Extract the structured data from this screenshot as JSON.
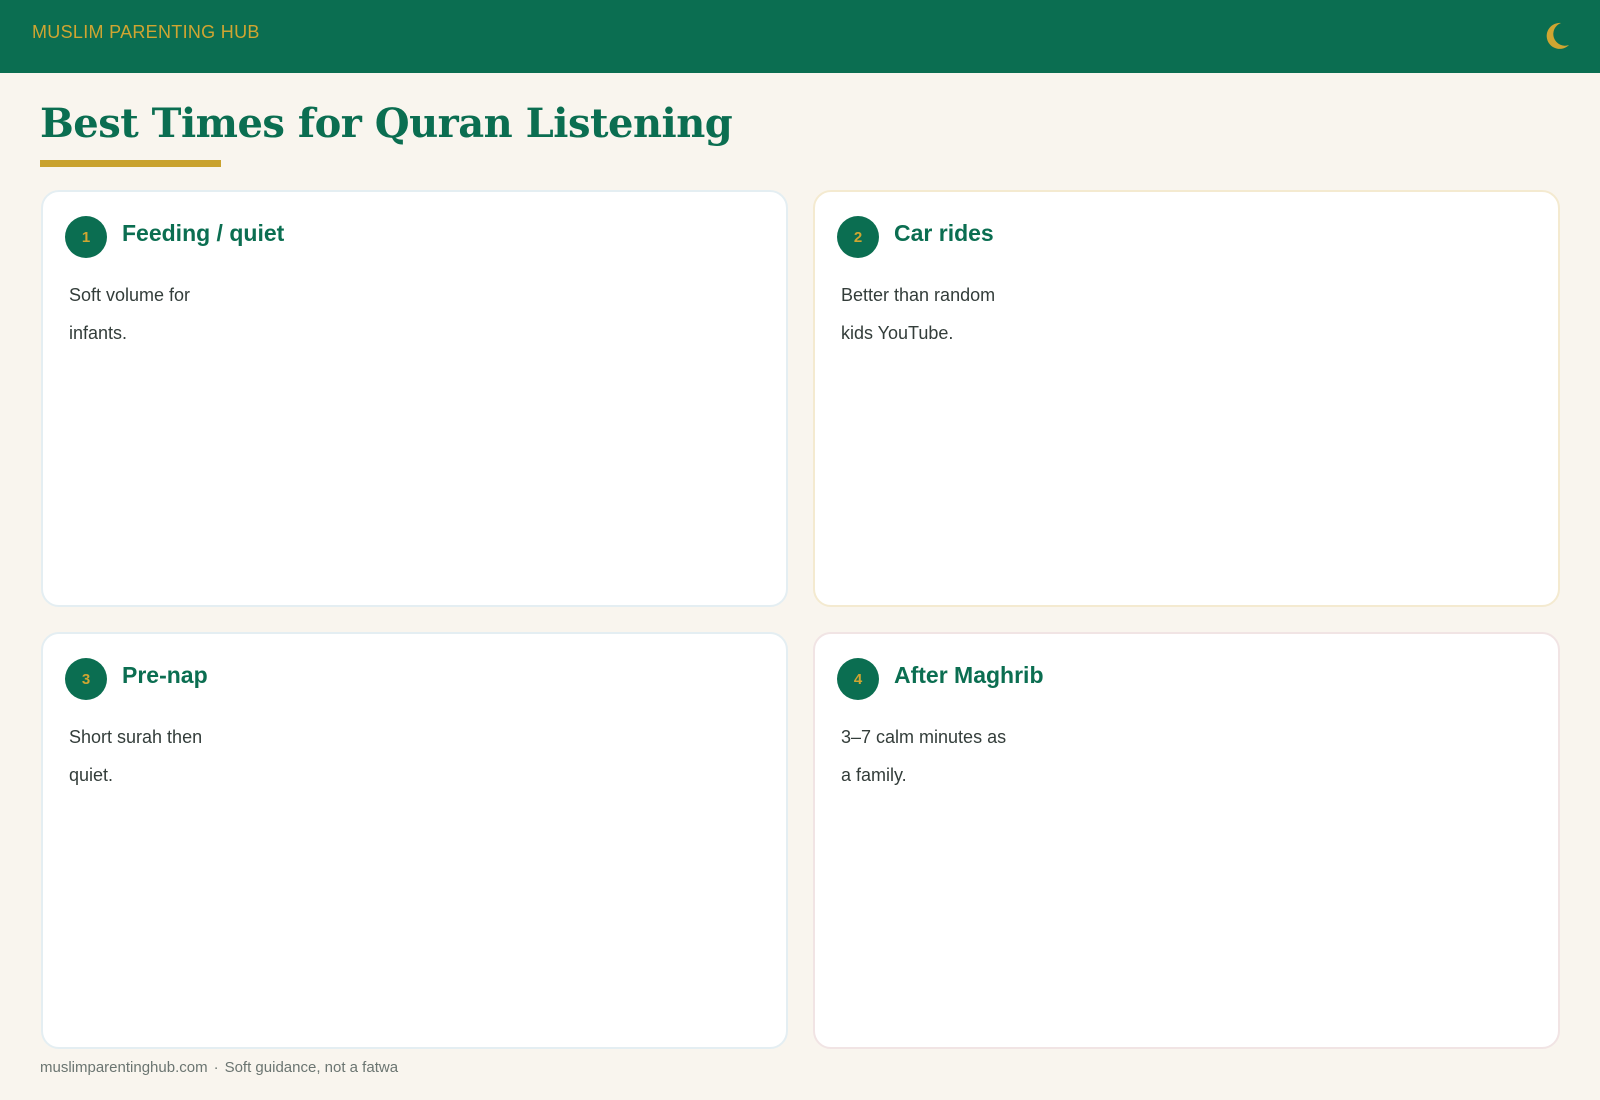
{
  "header": {
    "brand": "MUSLIM PARENTING HUB",
    "icon": "crescent-moon-icon",
    "bg_color": "#0b6e51",
    "accent_color": "#d0a531"
  },
  "page": {
    "title": "Best Times for Quran Listening"
  },
  "cards": [
    {
      "number": "1",
      "title": "Feeding / quiet",
      "body": "Soft volume for infants."
    },
    {
      "number": "2",
      "title": "Car rides",
      "body": "Better than random kids YouTube."
    },
    {
      "number": "3",
      "title": "Pre-nap",
      "body": "Short surah then quiet."
    },
    {
      "number": "4",
      "title": "After Maghrib",
      "body": "3–7 calm minutes as a family."
    }
  ],
  "footer": {
    "site": "muslimparentinghub.com",
    "separator": "·",
    "note": "Soft guidance, not a fatwa"
  }
}
